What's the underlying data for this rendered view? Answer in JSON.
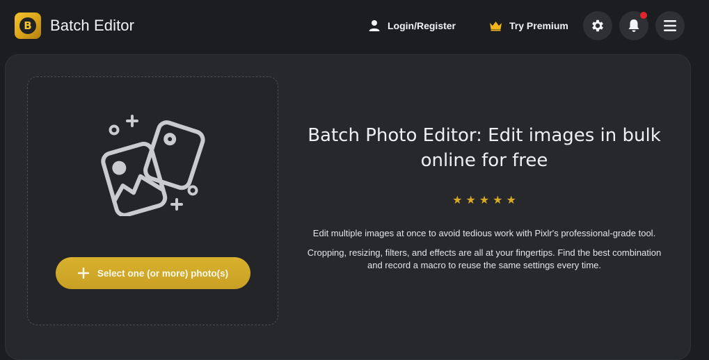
{
  "header": {
    "logo_letter": "B",
    "app_title": "Batch Editor",
    "login_label": "Login/Register",
    "premium_label": "Try Premium",
    "icons": [
      "user-icon",
      "crown-icon",
      "gear-icon",
      "bell-icon",
      "hamburger-menu-icon"
    ],
    "notification_badge_color": "#e0262c",
    "accent_color": "#f2c230"
  },
  "dropzone": {
    "illustration": "photos-stack-icon",
    "select_button_label": "Select one (or more) photo(s)",
    "select_button_icon": "plus-icon",
    "button_color": "#d4ab2a"
  },
  "hero": {
    "title": "Batch Photo Editor: Edit images in bulk online for free",
    "rating_stars": 5,
    "star_color": "#d7a926",
    "paragraph_1": "Edit multiple images at once to avoid tedious work with Pixlr's professional-grade tool.",
    "paragraph_2": "Cropping, resizing, filters, and effects are all at your fingertips. Find the best combination and record a macro to reuse the same settings every time."
  },
  "colors": {
    "background": "#1b1d20",
    "panel": "#26282c"
  }
}
